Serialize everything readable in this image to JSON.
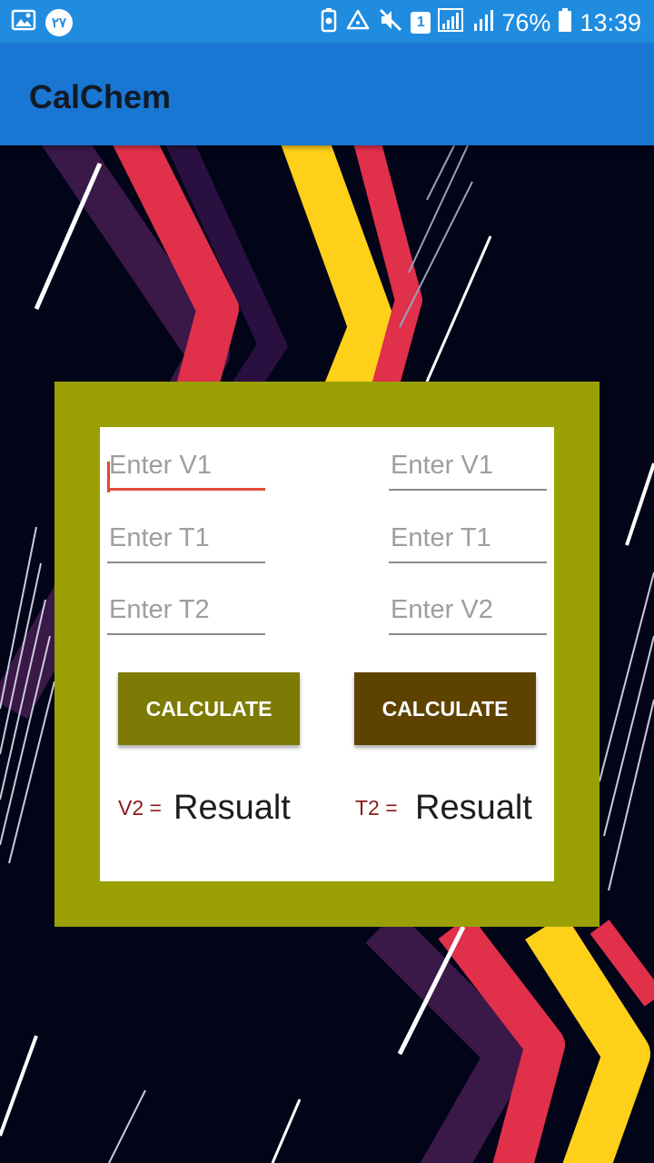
{
  "status_bar": {
    "notif_badge": "۲۷",
    "sim": "1",
    "battery": "76%",
    "time": "13:39"
  },
  "app": {
    "title": "CalChem"
  },
  "left_column": {
    "fields": [
      {
        "placeholder": "Enter V1",
        "value": ""
      },
      {
        "placeholder": "Enter T1",
        "value": ""
      },
      {
        "placeholder": "Enter T2",
        "value": ""
      }
    ],
    "calculate_label": "CALCULATE",
    "result_label": "V2 =",
    "result_value": "Resualt"
  },
  "right_column": {
    "fields": [
      {
        "placeholder": "Enter V1",
        "value": ""
      },
      {
        "placeholder": "Enter T1",
        "value": ""
      },
      {
        "placeholder": "Enter V2",
        "value": ""
      }
    ],
    "calculate_label": "CALCULATE",
    "result_label": "T2 =",
    "result_value": "Resualt"
  },
  "colors": {
    "status_bar": "#1f8ce0",
    "app_bar": "#1976d2",
    "frame": "#9aa003",
    "left_button": "#7d7a05",
    "right_button": "#5e4300",
    "focus_underline": "#e0483b",
    "result_label": "#8b1a1a"
  }
}
